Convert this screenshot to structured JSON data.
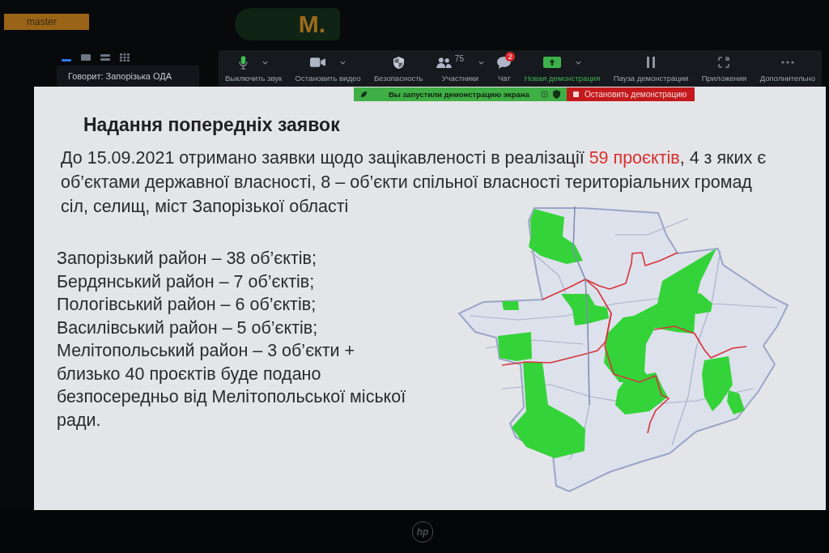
{
  "top_strip": {
    "tab": "master",
    "logo": "M."
  },
  "view_modes": [
    {
      "kind": "dash",
      "selected": true
    },
    {
      "kind": "tile",
      "selected": false
    },
    {
      "kind": "rows",
      "selected": false
    },
    {
      "kind": "grid",
      "selected": false
    }
  ],
  "speaker": "Говорит: Запорізька ОДА",
  "toolbar": [
    {
      "kind": "mic",
      "label": "Выключить звук",
      "menu": true
    },
    {
      "kind": "camera",
      "label": "Остановить видео",
      "menu": true
    },
    {
      "kind": "shield",
      "label": "Безопасность",
      "menu": false
    },
    {
      "kind": "people",
      "label": "Участники",
      "count": "75",
      "menu": true
    },
    {
      "kind": "chat",
      "label": "Чат",
      "badge": "2",
      "menu": false
    },
    {
      "kind": "share",
      "label": "Новая демонстрация",
      "menu": true
    },
    {
      "kind": "pause",
      "label": "Пауза демонстрации",
      "menu": false
    },
    {
      "kind": "apps",
      "label": "Приложения",
      "menu": false
    },
    {
      "kind": "more",
      "label": "Дополнительно",
      "menu": false
    }
  ],
  "share_bar": {
    "status": "Вы запустили демонстрацию экрана",
    "stop": "Остановить демонстрацию"
  },
  "slide": {
    "title": "Надання попередніх заявок",
    "intro": [
      {
        "text": "До 15.09.2021 отримано заявки щодо зацікавленості в реалізації ",
        "highlight": false
      },
      {
        "text": "59 проєктів",
        "highlight": true
      },
      {
        "text": ", 4 з яких є\nоб’єктами державної власності, 8 – об’єкти спільної власності територіальних громад\nсіл, селищ, міст Запорізької області",
        "highlight": false
      }
    ],
    "districts": [
      "Запорізький район – 38 об’єктів;",
      "Бердянський район – 7 об’єктів;",
      "Пологівський район – 6 об’єктів;",
      "Василівський район – 5 об’єктів;",
      "Мелітопольський район – 3 об’єкти +\nблизько 40 проєктів буде подано\nбезпосередньо від Мелітопольської міської\nради."
    ]
  },
  "bezel": {
    "logo": "hp"
  }
}
